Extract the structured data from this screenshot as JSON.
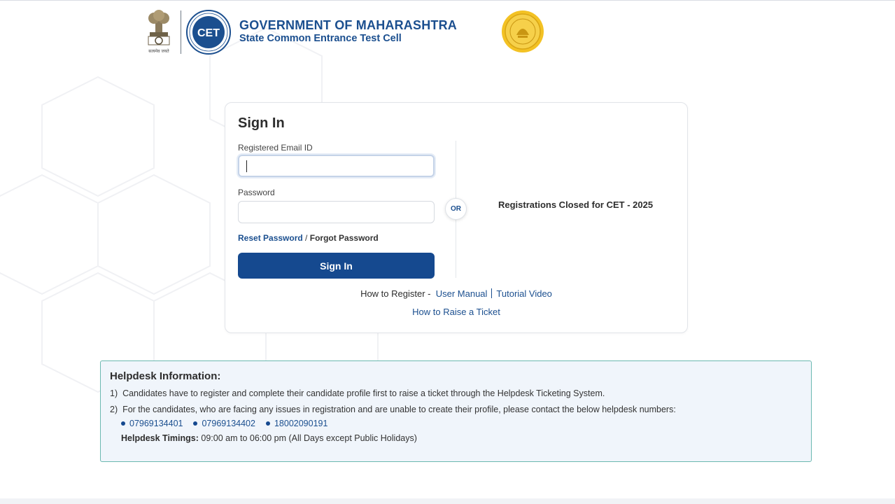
{
  "header": {
    "emblem_caption": "सत्यमेव जयते",
    "cet_logo_text": "CET",
    "title": "GOVERNMENT OF MAHARASHTRA",
    "subtitle": "State Common Entrance Test Cell"
  },
  "signin": {
    "title": "Sign In",
    "email_label": "Registered Email ID",
    "email_value": "",
    "password_label": "Password",
    "password_value": "",
    "reset_password": "Reset Password",
    "separator": " / ",
    "forgot_password": "Forgot Password",
    "button_label": "Sign In",
    "or_label": "OR",
    "registration_status": "Registrations Closed for CET - 2025",
    "how_to_register_label": "How to Register -",
    "user_manual": "User Manual",
    "tutorial_video": "Tutorial Video",
    "raise_ticket": "How to Raise a Ticket"
  },
  "helpdesk": {
    "title": "Helpdesk Information:",
    "line1_num": "1)",
    "line1": "Candidates have to register and complete their candidate profile first to raise a ticket through the Helpdesk Ticketing System.",
    "line2_num": "2)",
    "line2": "For the candidates, who are facing any issues in registration and are unable to create their profile, please contact the below helpdesk numbers:",
    "phones": [
      "07969134401",
      "07969134402",
      "18002090191"
    ],
    "timings_label": "Helpdesk Timings:",
    "timings_value": "09:00 am to 06:00 pm (All Days except Public Holidays)"
  },
  "colors": {
    "brand_blue": "#15498f",
    "link_blue": "#1b4f8f",
    "helpdesk_border": "#6bb8b0",
    "helpdesk_bg": "#f0f5fb"
  }
}
